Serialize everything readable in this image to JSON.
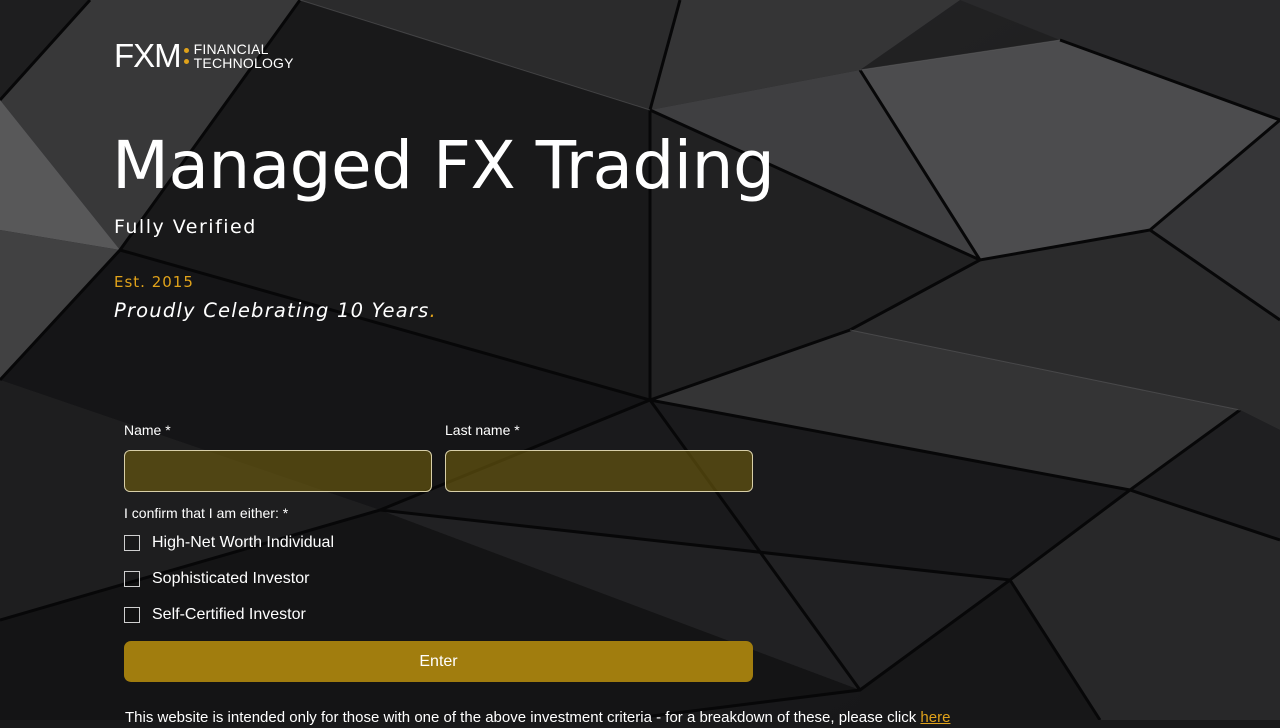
{
  "brand": {
    "logo_mark": "FXM",
    "logo_line1": "FINANCIAL",
    "logo_line2": "TECHNOLOGY",
    "accent_color": "#e0a21a"
  },
  "hero": {
    "title": "Managed FX Trading",
    "subtitle": "Fully Verified",
    "established": "Est. 2015",
    "celebration": "Proudly Celebrating 10 Years",
    "celebration_period": "."
  },
  "form": {
    "name_label": "Name *",
    "name_value": "",
    "lastname_label": "Last name *",
    "lastname_value": "",
    "confirm_label": "I confirm that I am either: *",
    "options": [
      {
        "label": "High-Net Worth Individual",
        "checked": false
      },
      {
        "label": "Sophisticated Investor",
        "checked": false
      },
      {
        "label": "Self-Certified Investor",
        "checked": false
      }
    ],
    "submit_label": "Enter",
    "button_color": "#a17d0e"
  },
  "footer": {
    "disclaimer": "This website is intended only for those with one of the above investment criteria - for a breakdown of these, please click ",
    "link_text": "here"
  }
}
